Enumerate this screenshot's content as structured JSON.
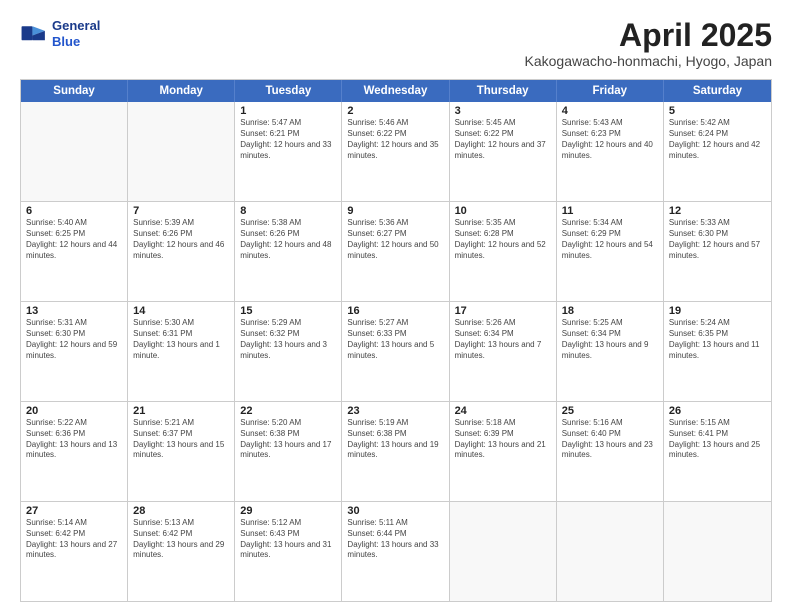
{
  "header": {
    "logo_line1": "General",
    "logo_line2": "Blue",
    "title": "April 2025",
    "subtitle": "Kakogawacho-honmachi, Hyogo, Japan"
  },
  "days": [
    "Sunday",
    "Monday",
    "Tuesday",
    "Wednesday",
    "Thursday",
    "Friday",
    "Saturday"
  ],
  "weeks": [
    [
      {
        "day": "",
        "empty": true
      },
      {
        "day": "",
        "empty": true
      },
      {
        "day": "1",
        "sunrise": "Sunrise: 5:47 AM",
        "sunset": "Sunset: 6:21 PM",
        "daylight": "Daylight: 12 hours and 33 minutes."
      },
      {
        "day": "2",
        "sunrise": "Sunrise: 5:46 AM",
        "sunset": "Sunset: 6:22 PM",
        "daylight": "Daylight: 12 hours and 35 minutes."
      },
      {
        "day": "3",
        "sunrise": "Sunrise: 5:45 AM",
        "sunset": "Sunset: 6:22 PM",
        "daylight": "Daylight: 12 hours and 37 minutes."
      },
      {
        "day": "4",
        "sunrise": "Sunrise: 5:43 AM",
        "sunset": "Sunset: 6:23 PM",
        "daylight": "Daylight: 12 hours and 40 minutes."
      },
      {
        "day": "5",
        "sunrise": "Sunrise: 5:42 AM",
        "sunset": "Sunset: 6:24 PM",
        "daylight": "Daylight: 12 hours and 42 minutes."
      }
    ],
    [
      {
        "day": "6",
        "sunrise": "Sunrise: 5:40 AM",
        "sunset": "Sunset: 6:25 PM",
        "daylight": "Daylight: 12 hours and 44 minutes."
      },
      {
        "day": "7",
        "sunrise": "Sunrise: 5:39 AM",
        "sunset": "Sunset: 6:26 PM",
        "daylight": "Daylight: 12 hours and 46 minutes."
      },
      {
        "day": "8",
        "sunrise": "Sunrise: 5:38 AM",
        "sunset": "Sunset: 6:26 PM",
        "daylight": "Daylight: 12 hours and 48 minutes."
      },
      {
        "day": "9",
        "sunrise": "Sunrise: 5:36 AM",
        "sunset": "Sunset: 6:27 PM",
        "daylight": "Daylight: 12 hours and 50 minutes."
      },
      {
        "day": "10",
        "sunrise": "Sunrise: 5:35 AM",
        "sunset": "Sunset: 6:28 PM",
        "daylight": "Daylight: 12 hours and 52 minutes."
      },
      {
        "day": "11",
        "sunrise": "Sunrise: 5:34 AM",
        "sunset": "Sunset: 6:29 PM",
        "daylight": "Daylight: 12 hours and 54 minutes."
      },
      {
        "day": "12",
        "sunrise": "Sunrise: 5:33 AM",
        "sunset": "Sunset: 6:30 PM",
        "daylight": "Daylight: 12 hours and 57 minutes."
      }
    ],
    [
      {
        "day": "13",
        "sunrise": "Sunrise: 5:31 AM",
        "sunset": "Sunset: 6:30 PM",
        "daylight": "Daylight: 12 hours and 59 minutes."
      },
      {
        "day": "14",
        "sunrise": "Sunrise: 5:30 AM",
        "sunset": "Sunset: 6:31 PM",
        "daylight": "Daylight: 13 hours and 1 minute."
      },
      {
        "day": "15",
        "sunrise": "Sunrise: 5:29 AM",
        "sunset": "Sunset: 6:32 PM",
        "daylight": "Daylight: 13 hours and 3 minutes."
      },
      {
        "day": "16",
        "sunrise": "Sunrise: 5:27 AM",
        "sunset": "Sunset: 6:33 PM",
        "daylight": "Daylight: 13 hours and 5 minutes."
      },
      {
        "day": "17",
        "sunrise": "Sunrise: 5:26 AM",
        "sunset": "Sunset: 6:34 PM",
        "daylight": "Daylight: 13 hours and 7 minutes."
      },
      {
        "day": "18",
        "sunrise": "Sunrise: 5:25 AM",
        "sunset": "Sunset: 6:34 PM",
        "daylight": "Daylight: 13 hours and 9 minutes."
      },
      {
        "day": "19",
        "sunrise": "Sunrise: 5:24 AM",
        "sunset": "Sunset: 6:35 PM",
        "daylight": "Daylight: 13 hours and 11 minutes."
      }
    ],
    [
      {
        "day": "20",
        "sunrise": "Sunrise: 5:22 AM",
        "sunset": "Sunset: 6:36 PM",
        "daylight": "Daylight: 13 hours and 13 minutes."
      },
      {
        "day": "21",
        "sunrise": "Sunrise: 5:21 AM",
        "sunset": "Sunset: 6:37 PM",
        "daylight": "Daylight: 13 hours and 15 minutes."
      },
      {
        "day": "22",
        "sunrise": "Sunrise: 5:20 AM",
        "sunset": "Sunset: 6:38 PM",
        "daylight": "Daylight: 13 hours and 17 minutes."
      },
      {
        "day": "23",
        "sunrise": "Sunrise: 5:19 AM",
        "sunset": "Sunset: 6:38 PM",
        "daylight": "Daylight: 13 hours and 19 minutes."
      },
      {
        "day": "24",
        "sunrise": "Sunrise: 5:18 AM",
        "sunset": "Sunset: 6:39 PM",
        "daylight": "Daylight: 13 hours and 21 minutes."
      },
      {
        "day": "25",
        "sunrise": "Sunrise: 5:16 AM",
        "sunset": "Sunset: 6:40 PM",
        "daylight": "Daylight: 13 hours and 23 minutes."
      },
      {
        "day": "26",
        "sunrise": "Sunrise: 5:15 AM",
        "sunset": "Sunset: 6:41 PM",
        "daylight": "Daylight: 13 hours and 25 minutes."
      }
    ],
    [
      {
        "day": "27",
        "sunrise": "Sunrise: 5:14 AM",
        "sunset": "Sunset: 6:42 PM",
        "daylight": "Daylight: 13 hours and 27 minutes."
      },
      {
        "day": "28",
        "sunrise": "Sunrise: 5:13 AM",
        "sunset": "Sunset: 6:42 PM",
        "daylight": "Daylight: 13 hours and 29 minutes."
      },
      {
        "day": "29",
        "sunrise": "Sunrise: 5:12 AM",
        "sunset": "Sunset: 6:43 PM",
        "daylight": "Daylight: 13 hours and 31 minutes."
      },
      {
        "day": "30",
        "sunrise": "Sunrise: 5:11 AM",
        "sunset": "Sunset: 6:44 PM",
        "daylight": "Daylight: 13 hours and 33 minutes."
      },
      {
        "day": "",
        "empty": true
      },
      {
        "day": "",
        "empty": true
      },
      {
        "day": "",
        "empty": true
      }
    ]
  ]
}
